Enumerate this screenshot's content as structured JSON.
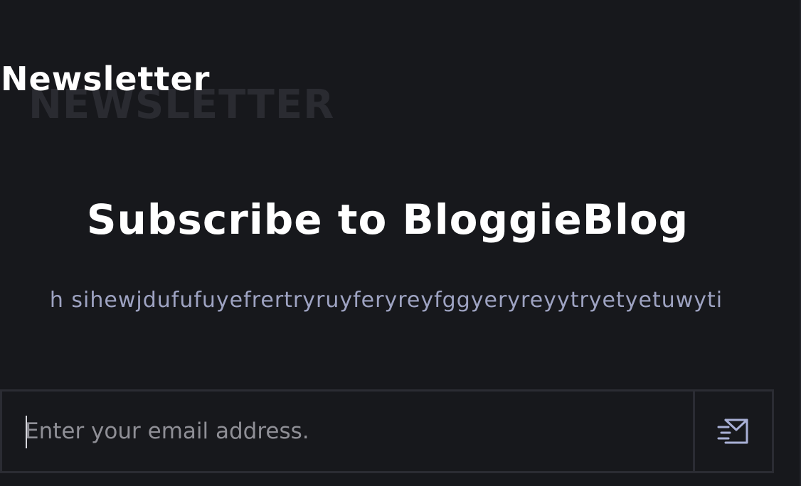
{
  "section": {
    "title": "Newsletter",
    "watermark": "NEWSLETTER"
  },
  "main": {
    "heading": "Subscribe to BloggieBlog",
    "description": "h sihewjdufufuyefrertryruyferyreyfggyeryreyytryetyetuwyti"
  },
  "form": {
    "email_placeholder": "Enter your email address.",
    "email_value": "",
    "submit_icon": "send-mail-icon"
  },
  "colors": {
    "background": "#17181c",
    "text_primary": "#ffffff",
    "text_secondary": "#9ea3c2",
    "border": "#2b2c33",
    "watermark": "#2a2b31",
    "icon": "#a9b0d6"
  }
}
